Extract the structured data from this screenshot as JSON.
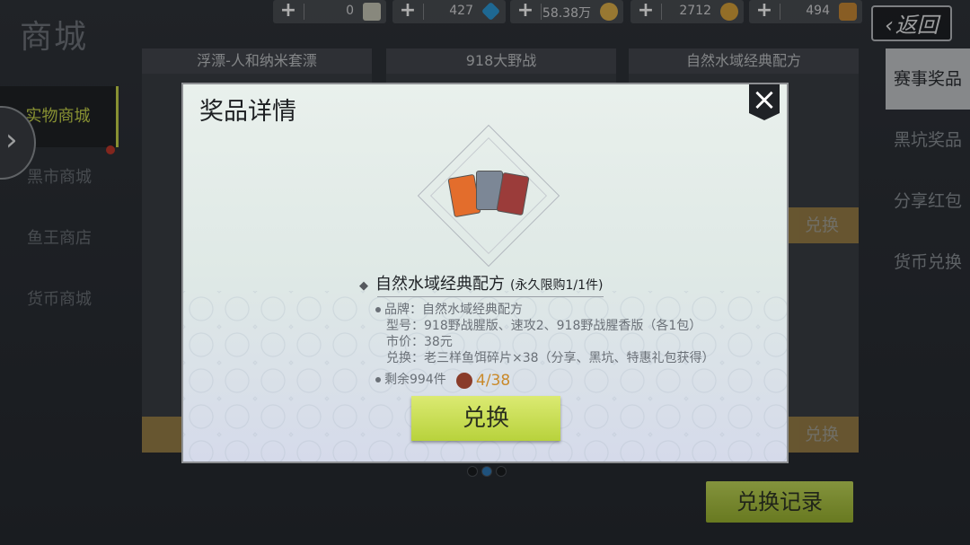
{
  "page": {
    "title": "商城"
  },
  "currencies": [
    {
      "value": "0",
      "color": "#c9c9b8",
      "icon": "ticket-icon"
    },
    {
      "value": "427",
      "color": "#2d9ad8",
      "icon": "diamond-icon"
    },
    {
      "value": "58.38万",
      "color": "#e0b24a",
      "icon": "gold-coin-icon"
    },
    {
      "value": "2712",
      "color": "#d9a23a",
      "icon": "fish-coin-icon"
    },
    {
      "value": "494",
      "color": "#c98a36",
      "icon": "voucher-icon"
    }
  ],
  "back_label": "返回",
  "left_nav": [
    {
      "label": "实物商城"
    },
    {
      "label": "黑市商城"
    },
    {
      "label": "鱼王商店"
    },
    {
      "label": "货币商城"
    }
  ],
  "right_nav": [
    {
      "label": "赛事奖品"
    },
    {
      "label": "黑坑奖品"
    },
    {
      "label": "分享红包"
    },
    {
      "label": "货币兑换"
    }
  ],
  "cards": [
    {
      "title": "浮漂-人和纳米套漂"
    },
    {
      "title": "918大野战"
    },
    {
      "title": "自然水域经典配方"
    }
  ],
  "card_buttons": [
    {
      "label": "兑换"
    },
    {
      "label": "兑换"
    }
  ],
  "exchange_record_label": "兑换记录",
  "modal": {
    "title": "奖品详情",
    "product_name": "自然水域经典配方",
    "purchase_limit": "(永久限购1/1件)",
    "details": [
      "品牌：自然水域经典配方",
      "型号：918野战腥版、速攻2、918野战腥香版（各1包）",
      "市价：38元",
      "兑换：老三样鱼饵碎片×38（分享、黑坑、特惠礼包获得）"
    ],
    "remaining": "剩余994件",
    "cost": "4/38",
    "exchange_label": "兑换"
  }
}
